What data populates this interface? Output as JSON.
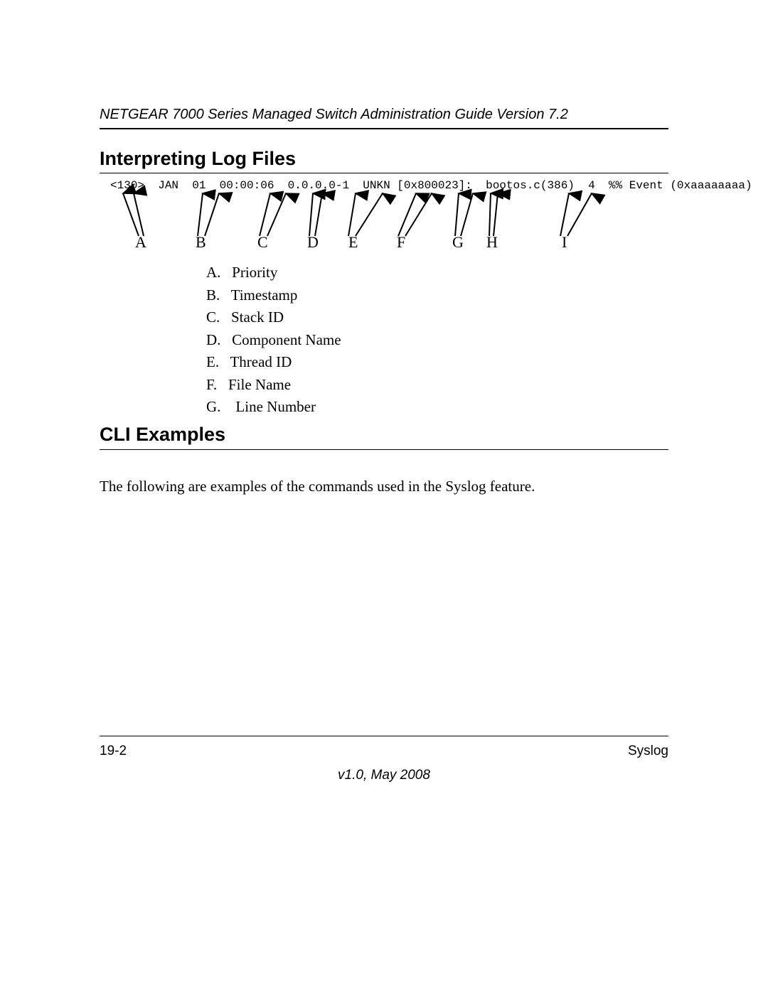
{
  "header": {
    "title": "NETGEAR 7000 Series Managed Switch Administration Guide Version 7.2"
  },
  "section1": {
    "title": "Interpreting Log Files",
    "logline": "<130>  JAN  01  00:00:06  0.0.0.0-1  UNKN [0x800023]:  bootos.c(386)  4  %% Event (0xaaaaaaaa)",
    "labels": {
      "A": "A",
      "B": "B",
      "C": "C",
      "D": "D",
      "E": "E",
      "F": "F",
      "G": "G",
      "H": "H",
      "I": "I"
    },
    "legend": {
      "A": "A.   Priority",
      "B": "B.   Timestamp",
      "C": "C.   Stack ID",
      "D": "D.   Component Name",
      "E": "E.   Thread ID",
      "F": "F.   File Name",
      "G": "G.    Line Number"
    }
  },
  "section2": {
    "title": "CLI Examples",
    "para": "The following are examples of the commands used in the Syslog feature."
  },
  "footer": {
    "left": "19-2",
    "right": "Syslog",
    "center": "v1.0, May 2008"
  }
}
